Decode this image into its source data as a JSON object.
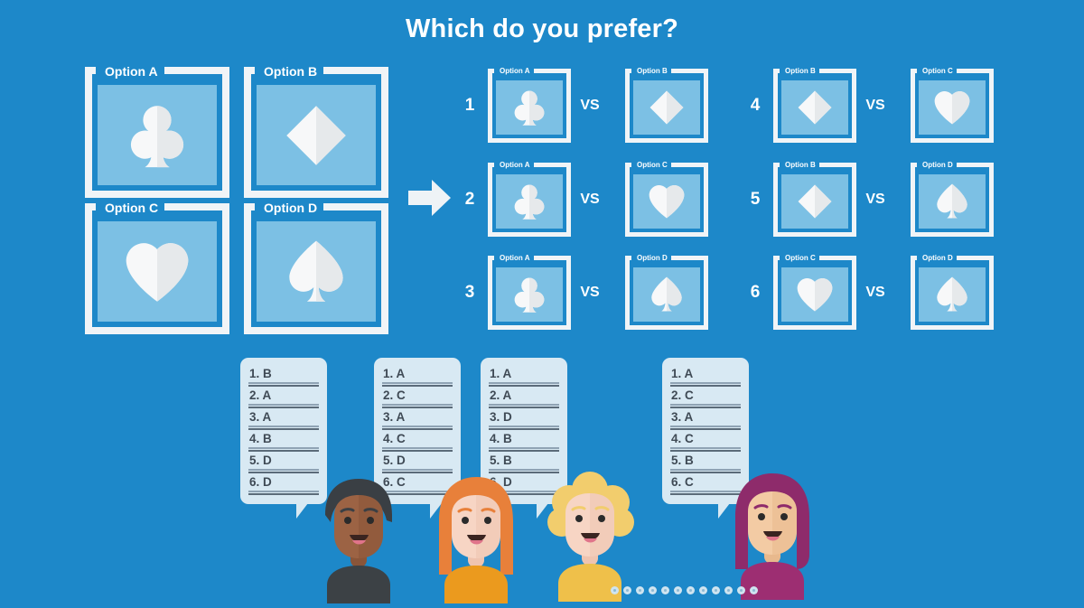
{
  "title": "Which do you prefer?",
  "colors": {
    "background": "#1d88c9",
    "frame": "#f0f4f7",
    "panel": "#7cc0e4",
    "suit": "#f2f4f5",
    "bubble": "#d8e9f3",
    "bubble_text": "#3f4a55"
  },
  "arrow": {
    "name": "right-arrow-icon"
  },
  "options": [
    {
      "label": "Option A",
      "suit": "club-icon"
    },
    {
      "label": "Option B",
      "suit": "diamond-icon"
    },
    {
      "label": "Option C",
      "suit": "heart-icon"
    },
    {
      "label": "Option D",
      "suit": "spade-icon"
    }
  ],
  "vs_label": "VS",
  "comparisons": [
    {
      "number": "1",
      "left": {
        "label": "Option A",
        "suit": "club-icon"
      },
      "right": {
        "label": "Option B",
        "suit": "diamond-icon"
      }
    },
    {
      "number": "2",
      "left": {
        "label": "Option A",
        "suit": "club-icon"
      },
      "right": {
        "label": "Option C",
        "suit": "heart-icon"
      }
    },
    {
      "number": "3",
      "left": {
        "label": "Option A",
        "suit": "club-icon"
      },
      "right": {
        "label": "Option D",
        "suit": "spade-icon"
      }
    },
    {
      "number": "4",
      "left": {
        "label": "Option B",
        "suit": "diamond-icon"
      },
      "right": {
        "label": "Option C",
        "suit": "heart-icon"
      }
    },
    {
      "number": "5",
      "left": {
        "label": "Option B",
        "suit": "diamond-icon"
      },
      "right": {
        "label": "Option D",
        "suit": "spade-icon"
      }
    },
    {
      "number": "6",
      "left": {
        "label": "Option C",
        "suit": "heart-icon"
      },
      "right": {
        "label": "Option D",
        "suit": "spade-icon"
      }
    }
  ],
  "responses": [
    {
      "answers": [
        "1. B",
        "2. A",
        "3. A",
        "4. B",
        "5. D",
        "6. D"
      ]
    },
    {
      "answers": [
        "1. A",
        "2. C",
        "3. A",
        "4. C",
        "5. D",
        "6. C"
      ]
    },
    {
      "answers": [
        "1. A",
        "2. A",
        "3. D",
        "4. B",
        "5. B",
        "6. D"
      ]
    },
    {
      "answers": [
        "1. A",
        "2. C",
        "3. A",
        "4. C",
        "5. B",
        "6. C"
      ]
    }
  ],
  "people": [
    {
      "name": "person-1",
      "hair": "#3a3f44",
      "skin": "#9c6344",
      "skin_shade": "#8a5539",
      "shirt": "#3c4145",
      "hair_style": "short"
    },
    {
      "name": "person-2",
      "hair": "#e8803a",
      "skin": "#f7d5c4",
      "skin_shade": "#efc4b0",
      "shirt": "#eb9a1e",
      "hair_style": "long"
    },
    {
      "name": "person-3",
      "hair": "#f2cd6d",
      "skin": "#f7d5c4",
      "skin_shade": "#efc4b0",
      "shirt": "#efc04a",
      "hair_style": "curly"
    },
    {
      "name": "person-4",
      "hair": "#8e2b6b",
      "skin": "#f3cba4",
      "skin_shade": "#e8b98d",
      "shirt": "#9d2e72",
      "hair_style": "bob"
    }
  ],
  "pagination": {
    "dot_count": 12
  }
}
